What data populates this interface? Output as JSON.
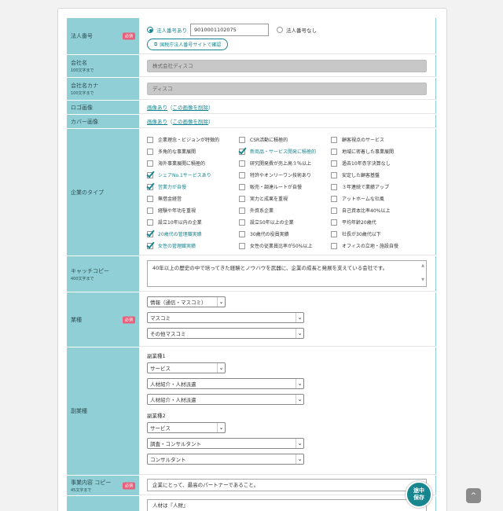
{
  "required_label": "必須",
  "corp_number": {
    "label": "法人番号",
    "option_yes": "法人番号あり",
    "value": "9010001102075",
    "option_no": "法人番号なし",
    "confirm_button": "国税庁法人番号サイトで確認"
  },
  "company_name": {
    "label": "会社名",
    "sub": "100文字まで",
    "value": "株式会社ディスコ"
  },
  "company_kana": {
    "label": "会社名カナ",
    "sub": "100文字まで",
    "value": "ディスコ"
  },
  "logo": {
    "label": "ロゴ画像",
    "link": "画像あり",
    "delete": "この画像を削除"
  },
  "cover": {
    "label": "カバー画像",
    "link": "画像あり",
    "delete": "この画像を削除"
  },
  "company_type": {
    "label": "企業のタイプ",
    "items": [
      {
        "text": "企業理念・ビジョンが特徴的",
        "checked": false
      },
      {
        "text": "CSR活動に積極的",
        "checked": false
      },
      {
        "text": "顧客視点のサービス",
        "checked": false
      },
      {
        "text": "多角的な事業展開",
        "checked": false
      },
      {
        "text": "新商品・サービス開発に積極的",
        "checked": true
      },
      {
        "text": "地域に密着した事業展開",
        "checked": false
      },
      {
        "text": "海外事業展開に積極的",
        "checked": false
      },
      {
        "text": "研究開発費が売上高３％以上",
        "checked": false
      },
      {
        "text": "過去10年赤字決算なし",
        "checked": false
      },
      {
        "text": "シェアNo.1サービスあり",
        "checked": true
      },
      {
        "text": "特許やオンリーワン技術あり",
        "checked": false
      },
      {
        "text": "安定した顧客基盤",
        "checked": false
      },
      {
        "text": "営業力が自慢",
        "checked": true
      },
      {
        "text": "販売・調達ルートが自慢",
        "checked": false
      },
      {
        "text": "３年連続で業績アップ",
        "checked": false
      },
      {
        "text": "無借金経営",
        "checked": false
      },
      {
        "text": "実力と成果を重視",
        "checked": false
      },
      {
        "text": "アットホームな社風",
        "checked": false
      },
      {
        "text": "経験や年功を重視",
        "checked": false
      },
      {
        "text": "外資系企業",
        "checked": false
      },
      {
        "text": "自己資本比率40%以上",
        "checked": false
      },
      {
        "text": "設立10年以内の企業",
        "checked": false
      },
      {
        "text": "設立50年以上の企業",
        "checked": false
      },
      {
        "text": "平均年齢20歳代",
        "checked": false
      },
      {
        "text": "20歳代の管理職実績",
        "checked": true
      },
      {
        "text": "30歳代の役員実績",
        "checked": false
      },
      {
        "text": "社長が30歳代以下",
        "checked": false
      },
      {
        "text": "女性の管理職実績",
        "checked": true
      },
      {
        "text": "女性の従業員比率が50%以上",
        "checked": false
      },
      {
        "text": "オフィスの立地・施設自慢",
        "checked": false
      }
    ]
  },
  "catch_copy": {
    "label": "キャッチコピー",
    "sub": "400文字まで",
    "value": "40年以上の歴史の中で培ってきた経験とノウハウを武器に、企業の成長と発展を支えている会社です。"
  },
  "industry": {
    "label": "業種",
    "sel1": "情報（通信・マスコミ）",
    "sel2": "マスコミ",
    "sel3": "その他マスコミ"
  },
  "sub_industry": {
    "label": "副業種",
    "group1": {
      "title": "副業種1",
      "sel1": "サービス",
      "sel2": "人材紹介・人材派遣",
      "sel3": "人材紹介・人材派遣"
    },
    "group2": {
      "title": "副業種2",
      "sel1": "サービス",
      "sel2": "調査・コンサルタント",
      "sel3": "コンサルタント"
    }
  },
  "business_copy": {
    "label": "事業内容 コピー",
    "sub": "45文字まで",
    "value": "企業にとって、最高のパートナーであること。"
  },
  "next_row": {
    "value": "人材は『人財』"
  },
  "fab": {
    "line1": "途中",
    "line2": "保存"
  },
  "top_arrow": "^"
}
